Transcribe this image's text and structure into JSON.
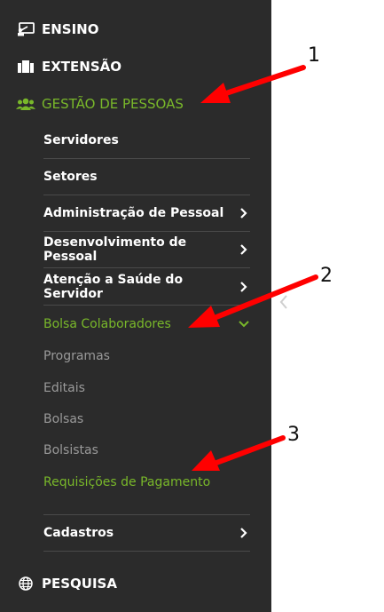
{
  "menu": {
    "ensino": "ENSINO",
    "extensao": "EXTENSÃO",
    "gestao": "GESTÃO DE PESSOAS",
    "pesquisa": "PESQUISA"
  },
  "submenu": {
    "servidores": "Servidores",
    "setores": "Setores",
    "administracao": "Administração de Pessoal",
    "desenvolvimento": "Desenvolvimento de Pessoal",
    "atencao": "Atenção a Saúde do Servidor",
    "bolsa": "Bolsa Colaboradores",
    "cadastros": "Cadastros"
  },
  "bolsa_items": {
    "programas": "Programas",
    "editais": "Editais",
    "bolsas": "Bolsas",
    "bolsistas": "Bolsistas",
    "requisicoes": "Requisições de Pagamento"
  },
  "annotations": [
    "1",
    "2",
    "3"
  ],
  "colors": {
    "sidebar_bg": "#2b2b2b",
    "accent": "#79b82a",
    "arrow": "#ff0000"
  }
}
